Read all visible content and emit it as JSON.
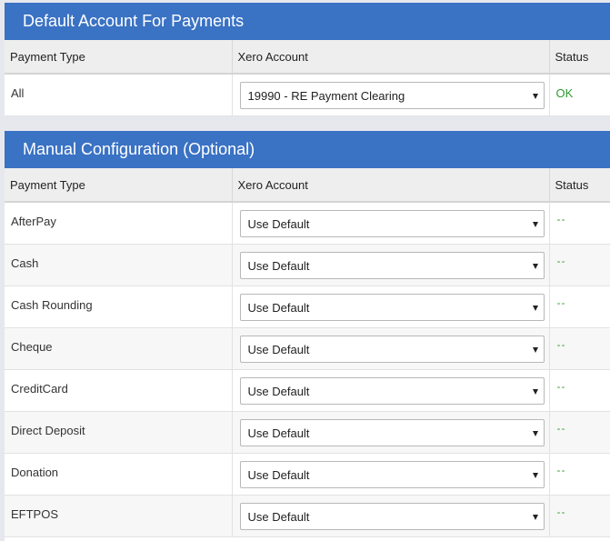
{
  "default_panel": {
    "title": "Default Account For Payments",
    "columns": [
      "Payment Type",
      "Xero Account",
      "Status"
    ],
    "rows": [
      {
        "payment_type": "All",
        "account": "19990 - RE Payment Clearing",
        "status": "OK"
      }
    ]
  },
  "manual_panel": {
    "title": "Manual Configuration (Optional)",
    "columns": [
      "Payment Type",
      "Xero Account",
      "Status"
    ],
    "rows": [
      {
        "payment_type": "AfterPay",
        "account": "Use Default",
        "status": "--"
      },
      {
        "payment_type": "Cash",
        "account": "Use Default",
        "status": "--"
      },
      {
        "payment_type": "Cash Rounding",
        "account": "Use Default",
        "status": "--"
      },
      {
        "payment_type": "Cheque",
        "account": "Use Default",
        "status": "--"
      },
      {
        "payment_type": "CreditCard",
        "account": "Use Default",
        "status": "--"
      },
      {
        "payment_type": "Direct Deposit",
        "account": "Use Default",
        "status": "--"
      },
      {
        "payment_type": "Donation",
        "account": "Use Default",
        "status": "--"
      },
      {
        "payment_type": "EFTPOS",
        "account": "Use Default",
        "status": "--"
      }
    ]
  },
  "colors": {
    "header_blue": "#3a72c4",
    "status_ok_green": "#2f9a2f"
  },
  "icons": {
    "select_arrow": "chevron-down-icon"
  }
}
